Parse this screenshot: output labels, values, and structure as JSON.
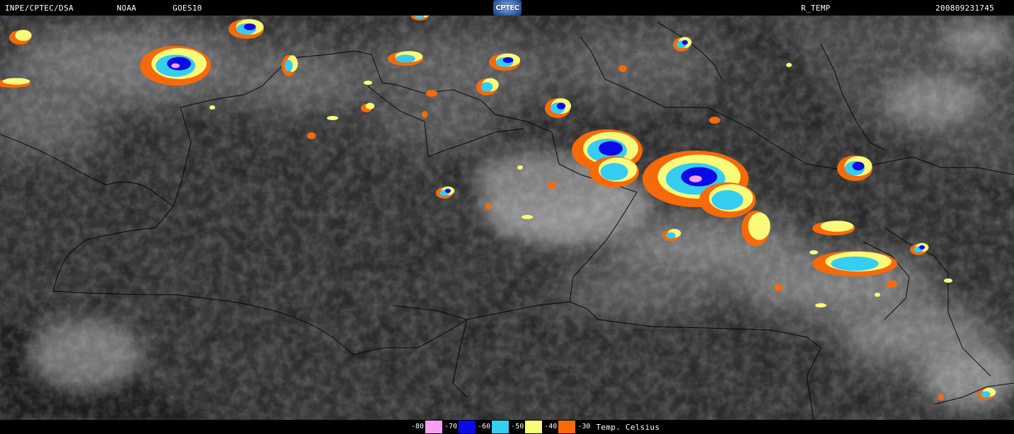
{
  "header": {
    "producer": "INPE/CPTEC/DSA",
    "agency": "NOAA",
    "satellite": "GOES10",
    "logo_text": "CPTEC",
    "product": "R_TEMP",
    "timestamp": "200809231745"
  },
  "legend": {
    "title": "Temp. Celsius",
    "items": [
      {
        "label": "-80",
        "color": "#f59ff0"
      },
      {
        "label": "-70",
        "color": "#0a0ae6"
      },
      {
        "label": "-60",
        "color": "#36cdf2"
      },
      {
        "label": "-50",
        "color": "#fbfb7a"
      },
      {
        "label": "-40",
        "color": "#f76a0a"
      },
      {
        "label": "-30",
        "color": ""
      }
    ]
  },
  "colors": {
    "background_land": "#3a3a3a",
    "ocean_dark": "#151515",
    "cloud_gray": "#9a9a9a",
    "border_lines": "#000000"
  }
}
